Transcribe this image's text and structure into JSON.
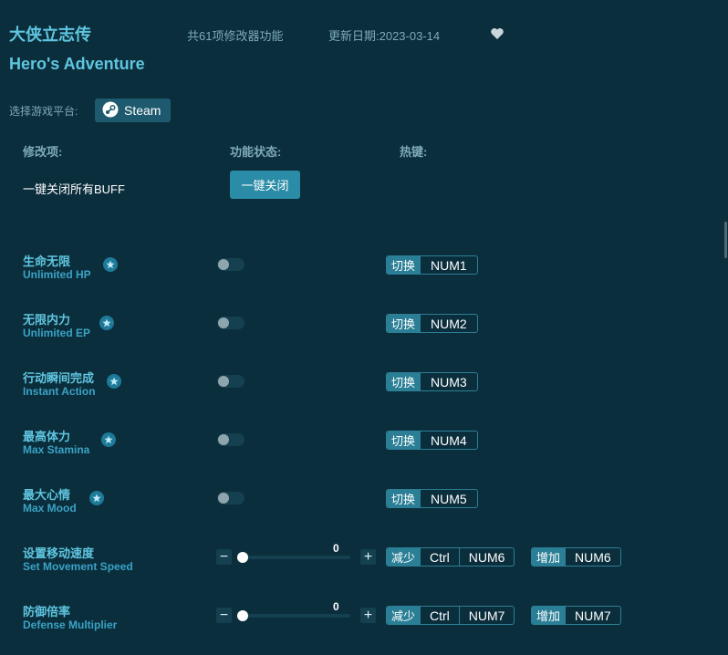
{
  "header": {
    "title_cn": "大侠立志传",
    "title_en": "Hero's Adventure",
    "feature_count": "共61项修改器功能",
    "update_date": "更新日期:2023-03-14"
  },
  "platform": {
    "label": "选择游戏平台:",
    "steam_label": "Steam"
  },
  "columns": {
    "item": "修改项:",
    "status": "功能状态:",
    "hotkey": "热键:"
  },
  "buff": {
    "label": "一键关闭所有BUFF",
    "button": "一键关闭"
  },
  "rows": [
    {
      "cn": "生命无限",
      "en": "Unlimited HP",
      "action": "切换",
      "key": "NUM1",
      "on": false
    },
    {
      "cn": "无限内力",
      "en": "Unlimited EP",
      "action": "切换",
      "key": "NUM2",
      "on": false
    },
    {
      "cn": "行动瞬间完成",
      "en": "Instant Action",
      "action": "切换",
      "key": "NUM3",
      "on": false
    },
    {
      "cn": "最高体力",
      "en": "Max Stamina",
      "action": "切换",
      "key": "NUM4",
      "on": false
    },
    {
      "cn": "最大心情",
      "en": "Max Mood",
      "action": "切换",
      "key": "NUM5",
      "on": false
    }
  ],
  "sliders": [
    {
      "cn": "设置移动速度",
      "en": "Set Movement Speed",
      "value": "0",
      "dec_label": "减少",
      "dec_mod": "Ctrl",
      "dec_key": "NUM6",
      "inc_label": "增加",
      "inc_key": "NUM6"
    },
    {
      "cn": "防御倍率",
      "en": "Defense Multiplier",
      "value": "0",
      "dec_label": "减少",
      "dec_mod": "Ctrl",
      "dec_key": "NUM7",
      "inc_label": "增加",
      "inc_key": "NUM7"
    }
  ],
  "icons": {
    "minus": "−",
    "plus": "+"
  },
  "colors": {
    "background": "#0b2e3c",
    "accent": "#5fc6e0",
    "button": "#2a8ca6"
  }
}
